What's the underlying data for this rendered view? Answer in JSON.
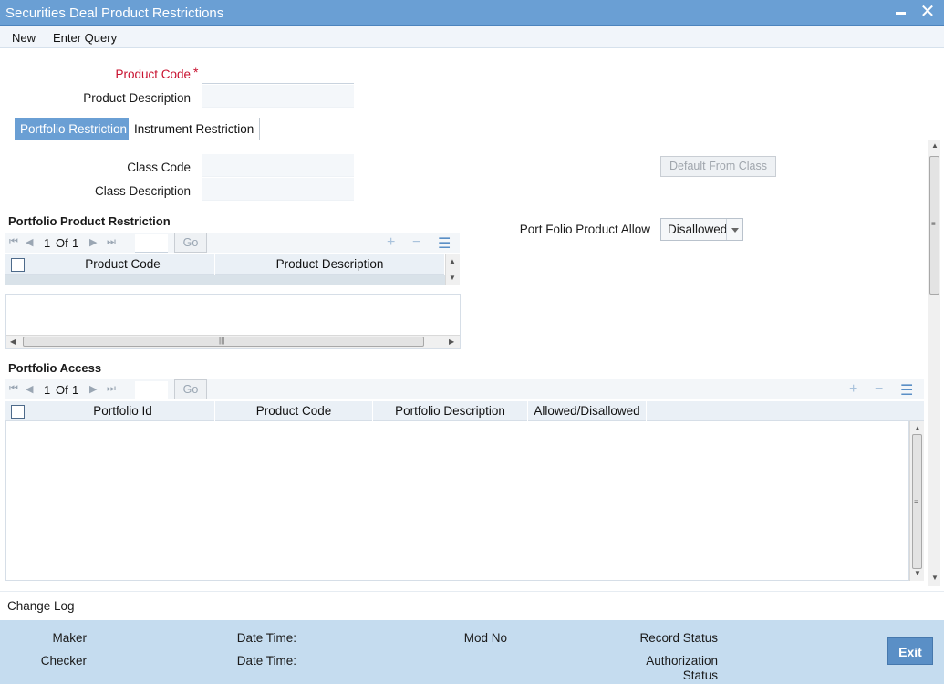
{
  "window": {
    "title": "Securities Deal Product Restrictions"
  },
  "menu": {
    "new": "New",
    "enter_query": "Enter Query"
  },
  "header": {
    "product_code_label": "Product Code",
    "required_mark": "*",
    "product_description_label": "Product Description",
    "product_code_value": "",
    "product_description_value": ""
  },
  "tabs": [
    {
      "label": "Portfolio Restriction",
      "active": true
    },
    {
      "label": "Instrument Restriction",
      "active": false
    }
  ],
  "class": {
    "class_code_label": "Class Code",
    "class_description_label": "Class Description",
    "default_from_class": "Default From Class"
  },
  "portfolio_product_restriction": {
    "title": "Portfolio Product Restriction",
    "page_current": "1",
    "page_of": "Of",
    "page_total": "1",
    "go": "Go",
    "columns": [
      "Product Code",
      "Product Description"
    ]
  },
  "port_folio_product_allow": {
    "label": "Port Folio Product Allow",
    "value": "Disallowed"
  },
  "portfolio_access": {
    "title": "Portfolio Access",
    "page_current": "1",
    "page_of": "Of",
    "page_total": "1",
    "go": "Go",
    "columns": [
      "Portfolio Id",
      "Product Code",
      "Portfolio Description",
      "Allowed/Disallowed"
    ]
  },
  "change_log": "Change Log",
  "footer": {
    "maker": "Maker",
    "checker": "Checker",
    "date_time_1": "Date Time:",
    "date_time_2": "Date Time:",
    "mod_no": "Mod No",
    "record_status": "Record Status",
    "authorization": "Authorization",
    "status": "Status",
    "exit": "Exit"
  },
  "icons": {
    "first": "first-page-icon",
    "prev": "prev-page-icon",
    "next": "next-page-icon",
    "last": "last-page-icon",
    "add": "add-row-icon",
    "delete": "delete-row-icon",
    "columns": "column-settings-icon"
  },
  "colors": {
    "accent": "#6a9fd4",
    "footer": "#c5dcef",
    "required": "#c8102e"
  }
}
